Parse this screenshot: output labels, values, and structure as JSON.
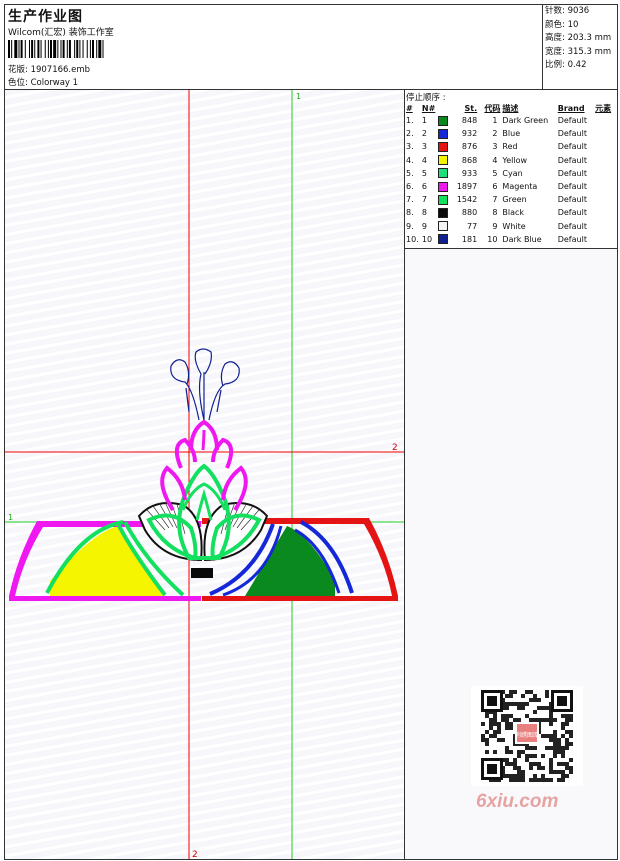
{
  "header": {
    "title": "生产作业图",
    "subtitle": "Wilcom(汇宏) 装饰工作室",
    "design_label": "花版: 1907166.emb",
    "colorway_label": "色位:  Colorway 1"
  },
  "stats": {
    "stitches": "针数:  9036",
    "colors": "颜色:  10",
    "height": "高度:  203.3 mm",
    "width": "宽度:  315.3 mm",
    "scale": "比例:  0.42"
  },
  "axis_labels": {
    "top": "1",
    "right": "2",
    "left": "1",
    "bottom": "2"
  },
  "stop_sequence": {
    "title": "停止顺序 :",
    "headers": [
      "#",
      "N#",
      "",
      "St.",
      "代码",
      "描述",
      "Brand",
      "元素"
    ],
    "rows": [
      {
        "idx": "1.",
        "n": "1",
        "st": "848",
        "code": "1",
        "desc": "Dark Green",
        "brand": "Default",
        "color": "#0a8a1e"
      },
      {
        "idx": "2.",
        "n": "2",
        "st": "932",
        "code": "2",
        "desc": "Blue",
        "brand": "Default",
        "color": "#1428d8"
      },
      {
        "idx": "3.",
        "n": "3",
        "st": "876",
        "code": "3",
        "desc": "Red",
        "brand": "Default",
        "color": "#e41414"
      },
      {
        "idx": "4.",
        "n": "4",
        "st": "868",
        "code": "4",
        "desc": "Yellow",
        "brand": "Default",
        "color": "#f5f500"
      },
      {
        "idx": "5.",
        "n": "5",
        "st": "933",
        "code": "5",
        "desc": "Cyan",
        "brand": "Default",
        "color": "#1ee07a"
      },
      {
        "idx": "6.",
        "n": "6",
        "st": "1897",
        "code": "6",
        "desc": "Magenta",
        "brand": "Default",
        "color": "#f018f0"
      },
      {
        "idx": "7.",
        "n": "7",
        "st": "1542",
        "code": "7",
        "desc": "Green",
        "brand": "Default",
        "color": "#14e060"
      },
      {
        "idx": "8.",
        "n": "8",
        "st": "880",
        "code": "8",
        "desc": "Black",
        "brand": "Default",
        "color": "#0a0a0a"
      },
      {
        "idx": "9.",
        "n": "9",
        "st": "77",
        "code": "9",
        "desc": "White",
        "brand": "Default",
        "color": "#f4f4f4"
      },
      {
        "idx": "10.",
        "n": "10",
        "st": "181",
        "code": "10",
        "desc": "Dark Blue",
        "brand": "Default",
        "color": "#102090"
      }
    ]
  },
  "watermark": {
    "text": "6xiu.com",
    "stamp": "刺绣图库"
  }
}
